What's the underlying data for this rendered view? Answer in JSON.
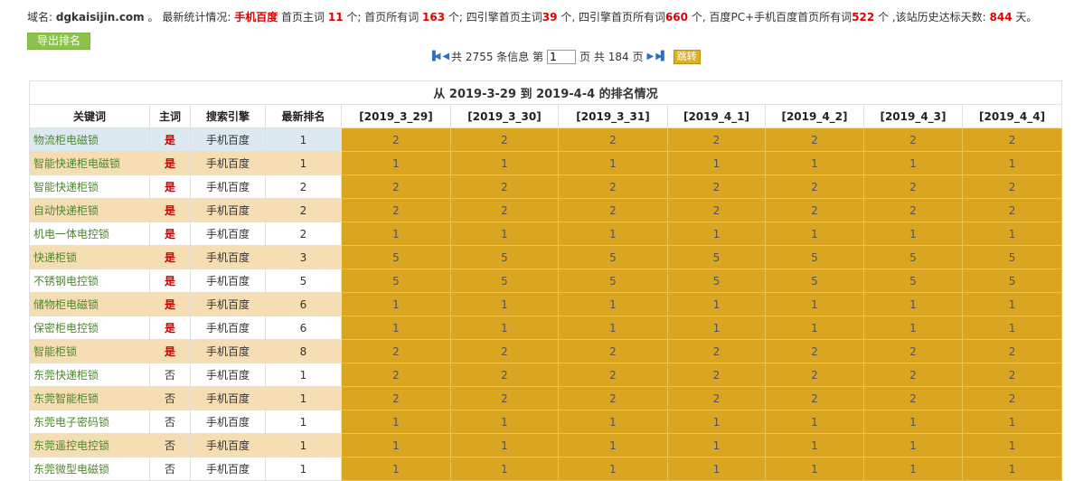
{
  "stats": {
    "p1": "域名: ",
    "domain": "dgkaisijin.com",
    "p2": " 。 最新统计情况: ",
    "engine": "手机百度",
    "p3": " 首页主词 ",
    "home_main": "11",
    "p4": " 个; 首页所有词 ",
    "home_all": "163",
    "p5": " 个; 四引擎首页主词",
    "four_main": "39",
    "p6": " 个, 四引擎首页所有词",
    "four_all": "660",
    "p7": " 个, 百度PC+手机百度首页所有词",
    "pc_mobile": "522",
    "p8": " 个 ,该站历史达标天数: ",
    "days": "844",
    "p9": " 天。"
  },
  "export_label": "导出排名",
  "pager": {
    "first": "▐◀",
    "prev": "◀",
    "total_prefix": "共 ",
    "total_records": "2755",
    "total_suffix": " 条信息 第",
    "current_page": "1",
    "page_mid": "页 共 ",
    "total_pages": "184",
    "page_suffix": " 页",
    "next": "▶",
    "last": "▶▌",
    "go_label": "跳转"
  },
  "table": {
    "title": "从 2019-3-29 到 2019-4-4 的排名情况",
    "headers": [
      "关键词",
      "主词",
      "搜索引擎",
      "最新排名",
      "[2019_3_29]",
      "[2019_3_30]",
      "[2019_3_31]",
      "[2019_4_1]",
      "[2019_4_2]",
      "[2019_4_3]",
      "[2019_4_4]"
    ],
    "rows": [
      {
        "kw": "物流柜电磁锁",
        "main": "是",
        "engine": "手机百度",
        "latest": "1",
        "ranks": [
          "2",
          "2",
          "2",
          "2",
          "2",
          "2",
          "2"
        ]
      },
      {
        "kw": "智能快递柜电磁锁",
        "main": "是",
        "engine": "手机百度",
        "latest": "1",
        "ranks": [
          "1",
          "1",
          "1",
          "1",
          "1",
          "1",
          "1"
        ]
      },
      {
        "kw": "智能快递柜锁",
        "main": "是",
        "engine": "手机百度",
        "latest": "2",
        "ranks": [
          "2",
          "2",
          "2",
          "2",
          "2",
          "2",
          "2"
        ]
      },
      {
        "kw": "自动快递柜锁",
        "main": "是",
        "engine": "手机百度",
        "latest": "2",
        "ranks": [
          "2",
          "2",
          "2",
          "2",
          "2",
          "2",
          "2"
        ]
      },
      {
        "kw": "机电一体电控锁",
        "main": "是",
        "engine": "手机百度",
        "latest": "2",
        "ranks": [
          "1",
          "1",
          "1",
          "1",
          "1",
          "1",
          "1"
        ]
      },
      {
        "kw": "快递柜锁",
        "main": "是",
        "engine": "手机百度",
        "latest": "3",
        "ranks": [
          "5",
          "5",
          "5",
          "5",
          "5",
          "5",
          "5"
        ]
      },
      {
        "kw": "不锈钢电控锁",
        "main": "是",
        "engine": "手机百度",
        "latest": "5",
        "ranks": [
          "5",
          "5",
          "5",
          "5",
          "5",
          "5",
          "5"
        ]
      },
      {
        "kw": "储物柜电磁锁",
        "main": "是",
        "engine": "手机百度",
        "latest": "6",
        "ranks": [
          "1",
          "1",
          "1",
          "1",
          "1",
          "1",
          "1"
        ]
      },
      {
        "kw": "保密柜电控锁",
        "main": "是",
        "engine": "手机百度",
        "latest": "6",
        "ranks": [
          "1",
          "1",
          "1",
          "1",
          "1",
          "1",
          "1"
        ]
      },
      {
        "kw": "智能柜锁",
        "main": "是",
        "engine": "手机百度",
        "latest": "8",
        "ranks": [
          "2",
          "2",
          "2",
          "2",
          "2",
          "2",
          "2"
        ]
      },
      {
        "kw": "东莞快递柜锁",
        "main": "否",
        "engine": "手机百度",
        "latest": "1",
        "ranks": [
          "2",
          "2",
          "2",
          "2",
          "2",
          "2",
          "2"
        ]
      },
      {
        "kw": "东莞智能柜锁",
        "main": "否",
        "engine": "手机百度",
        "latest": "1",
        "ranks": [
          "2",
          "2",
          "2",
          "2",
          "2",
          "2",
          "2"
        ]
      },
      {
        "kw": "东莞电子密码锁",
        "main": "否",
        "engine": "手机百度",
        "latest": "1",
        "ranks": [
          "1",
          "1",
          "1",
          "1",
          "1",
          "1",
          "1"
        ]
      },
      {
        "kw": "东莞遥控电控锁",
        "main": "否",
        "engine": "手机百度",
        "latest": "1",
        "ranks": [
          "1",
          "1",
          "1",
          "1",
          "1",
          "1",
          "1"
        ]
      },
      {
        "kw": "东莞微型电磁锁",
        "main": "否",
        "engine": "手机百度",
        "latest": "1",
        "ranks": [
          "1",
          "1",
          "1",
          "1",
          "1",
          "1",
          "1"
        ]
      }
    ]
  },
  "colors": {
    "rank_bg": "#daa520",
    "row_alt_bg": "#f5deb3",
    "first_row_bg": "#dce9f1",
    "keyword_text": "#4a8a2c",
    "highlight_red": "#e00000",
    "export_btn": "#8bc34a"
  }
}
